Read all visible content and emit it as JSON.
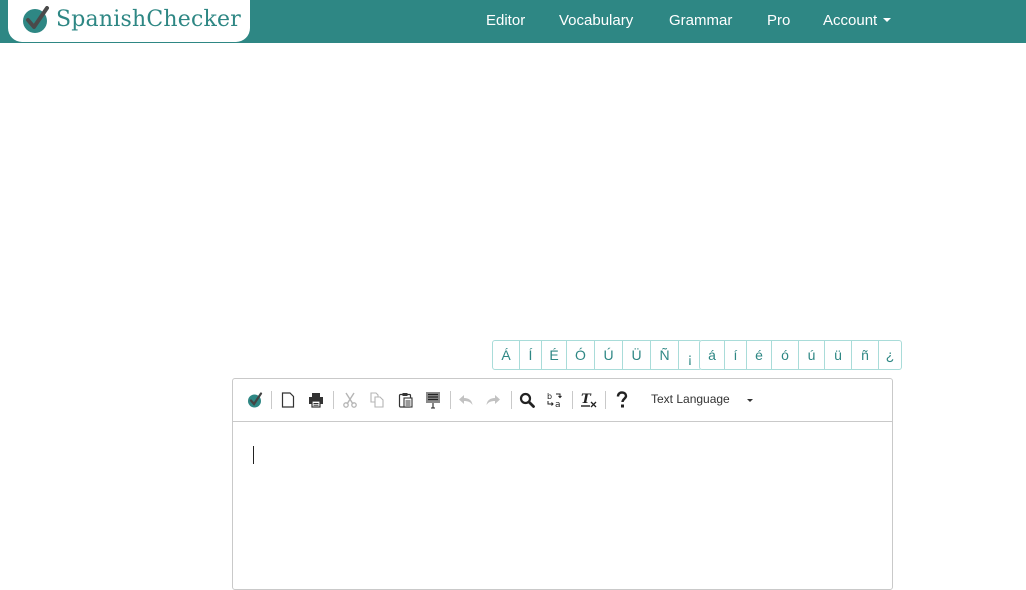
{
  "brand": {
    "name": "SpanishChecker",
    "logo_icon": "checkmark-circle-icon",
    "color": "#2e8784"
  },
  "nav": {
    "items": [
      {
        "label": "Editor"
      },
      {
        "label": "Vocabulary"
      },
      {
        "label": "Grammar"
      },
      {
        "label": "Pro"
      },
      {
        "label": "Account",
        "dropdown": true
      }
    ]
  },
  "special_chars": {
    "uppercase": [
      "Á",
      "Í",
      "É",
      "Ó",
      "Ú",
      "Ü",
      "Ñ",
      "¡"
    ],
    "lowercase": [
      "á",
      "í",
      "é",
      "ó",
      "ú",
      "ü",
      "ñ",
      "¿"
    ]
  },
  "editor": {
    "toolbar": [
      {
        "icon": "spellcheck-icon",
        "label": "Check spelling"
      },
      {
        "icon": "new-page-icon",
        "label": "New Page"
      },
      {
        "icon": "print-icon",
        "label": "Print"
      },
      {
        "icon": "cut-icon",
        "label": "Cut",
        "disabled": true
      },
      {
        "icon": "copy-icon",
        "label": "Copy",
        "disabled": true
      },
      {
        "icon": "paste-icon",
        "label": "Paste"
      },
      {
        "icon": "paste-text-icon",
        "label": "Paste as plain text"
      },
      {
        "icon": "undo-icon",
        "label": "Undo",
        "disabled": true
      },
      {
        "icon": "redo-icon",
        "label": "Redo",
        "disabled": true
      },
      {
        "icon": "find-icon",
        "label": "Find"
      },
      {
        "icon": "replace-icon",
        "label": "Replace"
      },
      {
        "icon": "remove-format-icon",
        "label": "Remove Format"
      },
      {
        "icon": "help-icon",
        "label": "About"
      }
    ],
    "language_select": {
      "label": "Text Language"
    },
    "content": ""
  }
}
